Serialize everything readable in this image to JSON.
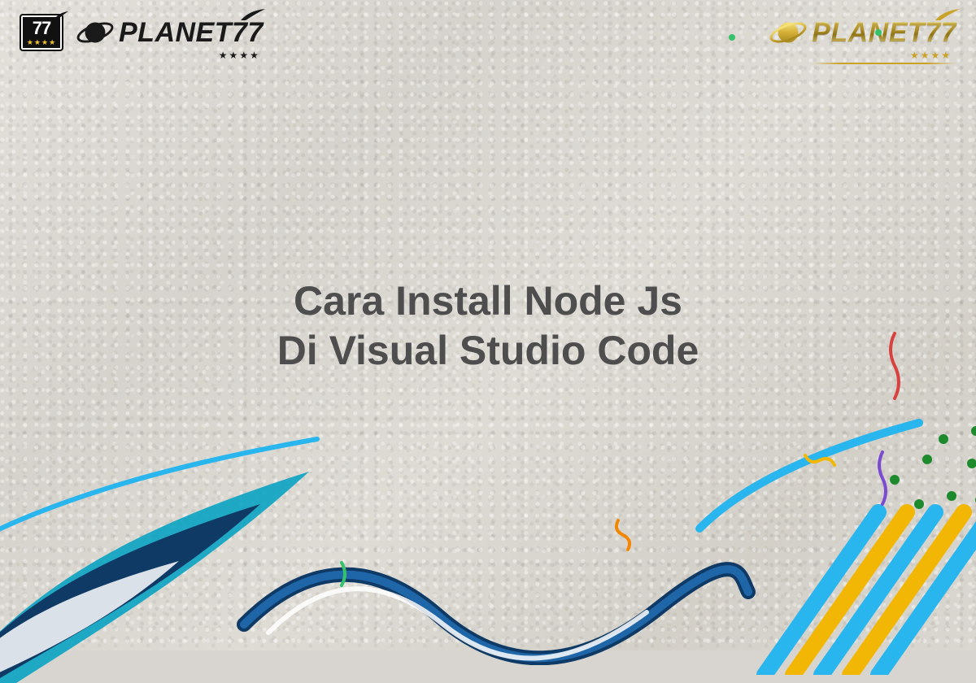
{
  "logos": {
    "badge": {
      "number": "77",
      "stars": "★★★★"
    },
    "brand_black": {
      "text": "PLANET77",
      "stars": "★★★★"
    },
    "brand_gold": {
      "text": "PLANET77",
      "stars": "★★★★"
    }
  },
  "title": {
    "line1": "Cara Install Node Js",
    "line2": "Di Visual Studio Code"
  },
  "palette": {
    "text_dark": "#4e4e4e",
    "navy": "#0f3a66",
    "teal": "#0aa3c2",
    "sky": "#29b6ef",
    "gold": "#f2b705",
    "orange": "#f28705",
    "red": "#d94141",
    "violet": "#7b4bd1",
    "green": "#35c26b"
  }
}
